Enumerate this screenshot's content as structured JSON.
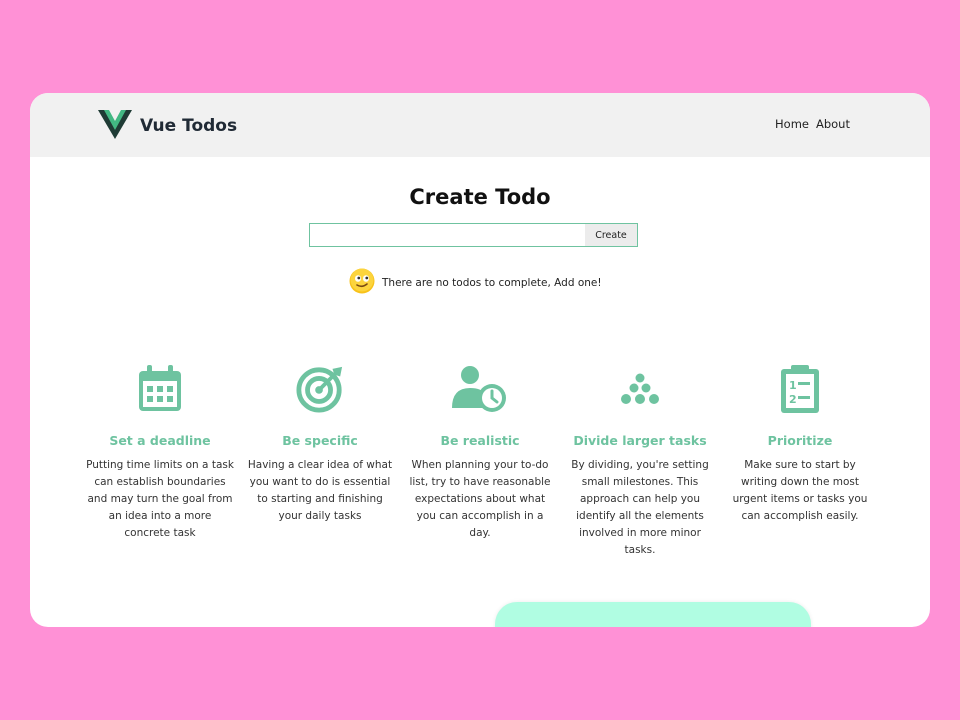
{
  "brand": {
    "name": "Vue Todos",
    "logo_icon": "vue-logo-icon"
  },
  "nav": {
    "home": "Home",
    "about": "About"
  },
  "main": {
    "title": "Create Todo",
    "input": {
      "value": "",
      "placeholder": ""
    },
    "create_label": "Create",
    "empty_message": "There are no todos to complete, Add one!",
    "empty_icon": "emoji-face-icon"
  },
  "tips": [
    {
      "icon": "calendar-icon",
      "title": "Set a deadline",
      "desc": "Putting time limits on a task can establish boundaries and may turn the goal from an idea into a more concrete task"
    },
    {
      "icon": "target-icon",
      "title": "Be specific",
      "desc": "Having a clear idea of what you want to do is essential to starting and finishing your daily tasks"
    },
    {
      "icon": "user-clock-icon",
      "title": "Be realistic",
      "desc": "When planning your to-do list, try to have reasonable expectations about what you can accomplish in a day."
    },
    {
      "icon": "dots-pyramid-icon",
      "title": "Divide larger tasks",
      "desc": "By dividing, you're setting small milestones. This approach can help you identify all the elements involved in more minor tasks."
    },
    {
      "icon": "clipboard-list-icon",
      "title": "Prioritize",
      "desc": "Make sure to start by writing down the most urgent items or tasks you can accomplish easily."
    }
  ],
  "colors": {
    "background": "#ff91d6",
    "accent": "#6ec3a0",
    "navbar": "#f1f1f1",
    "fab": "#b0fde2"
  }
}
